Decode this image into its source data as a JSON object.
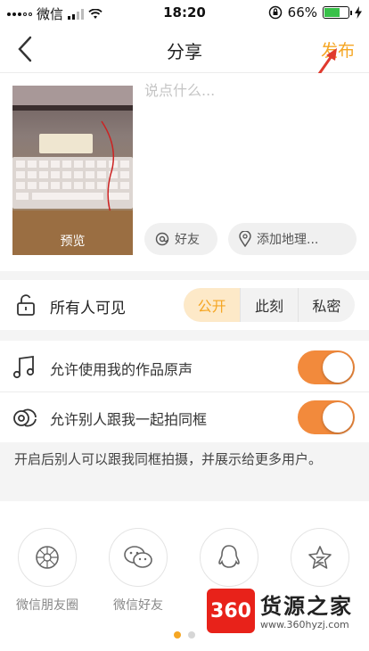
{
  "status_bar": {
    "carrier": "微信",
    "time": "18:20",
    "battery": "66%",
    "battery_level": 0.66,
    "colors": {
      "battery_fill": "#38c149"
    }
  },
  "nav": {
    "title": "分享",
    "publish_label": "发布",
    "accent": "#f5a623"
  },
  "compose": {
    "placeholder": "说点什么...",
    "photo_label": "预览",
    "friends_label": "好友",
    "location_label": "添加地理..."
  },
  "privacy": {
    "label": "所有人可见",
    "options": [
      "公开",
      "此刻",
      "私密"
    ],
    "selected": "公开"
  },
  "toggles": [
    {
      "label": "允许使用我的作品原声",
      "on": true,
      "icon": "music-note-icon"
    },
    {
      "label": "允许别人跟我一起拍同框",
      "on": true,
      "icon": "duet-icon"
    }
  ],
  "hint": "开启后别人可以跟我同框拍摄，并展示给更多用户。",
  "share": {
    "items": [
      {
        "label": "微信朋友圈",
        "icon": "moments-icon"
      },
      {
        "label": "微信好友",
        "icon": "wechat-icon"
      },
      {
        "label": "",
        "icon": "qq-icon"
      },
      {
        "label": "",
        "icon": "qzone-icon"
      }
    ],
    "page_count": 2,
    "active_page": 1
  },
  "watermark": {
    "logo": "360",
    "brand": "货源之家",
    "url": "www.360hyzj.com"
  }
}
